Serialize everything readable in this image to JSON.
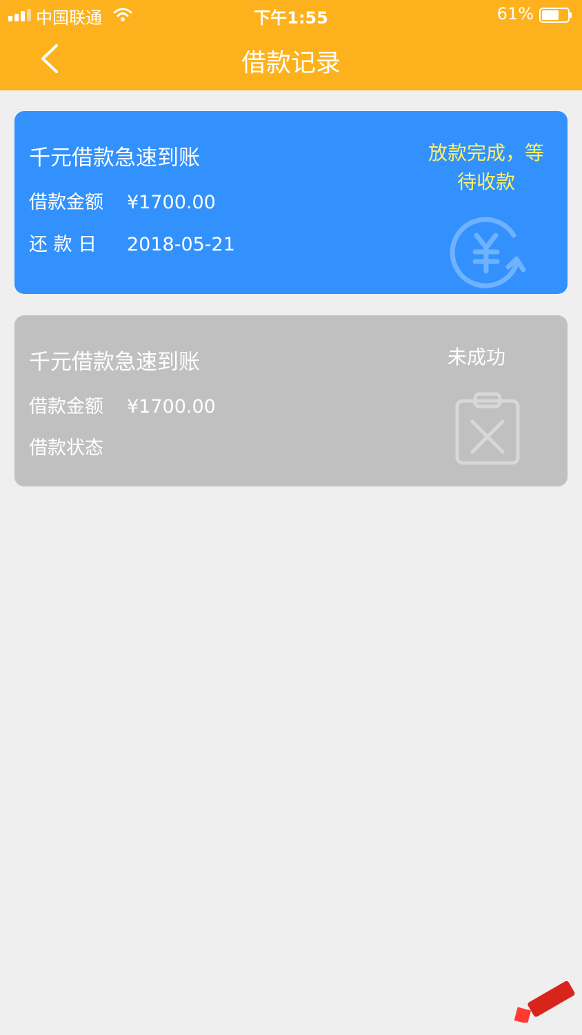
{
  "status_bar": {
    "carrier": "中国联通",
    "time": "下午1:55",
    "battery": "61%"
  },
  "header": {
    "title": "借款记录",
    "back_icon": "chevron-left-icon"
  },
  "records": [
    {
      "title": "千元借款急速到账",
      "amount_label": "借款金额",
      "amount": "¥1700.00",
      "date_label": "还 款 日",
      "date": "2018-05-21",
      "status_line1": "放款完成，等",
      "status_line2": "待收款",
      "icon": "yuan-refresh-icon",
      "color": "#3391fd",
      "status_color": "#fff16a"
    },
    {
      "title": "千元借款急速到账",
      "amount_label": "借款金额",
      "amount": "¥1700.00",
      "state_label": "借款状态",
      "status": "未成功",
      "icon": "clipboard-x-icon",
      "color": "#c0c0c0"
    }
  ],
  "colors": {
    "header": "#fdb21d",
    "background": "#efefef"
  }
}
